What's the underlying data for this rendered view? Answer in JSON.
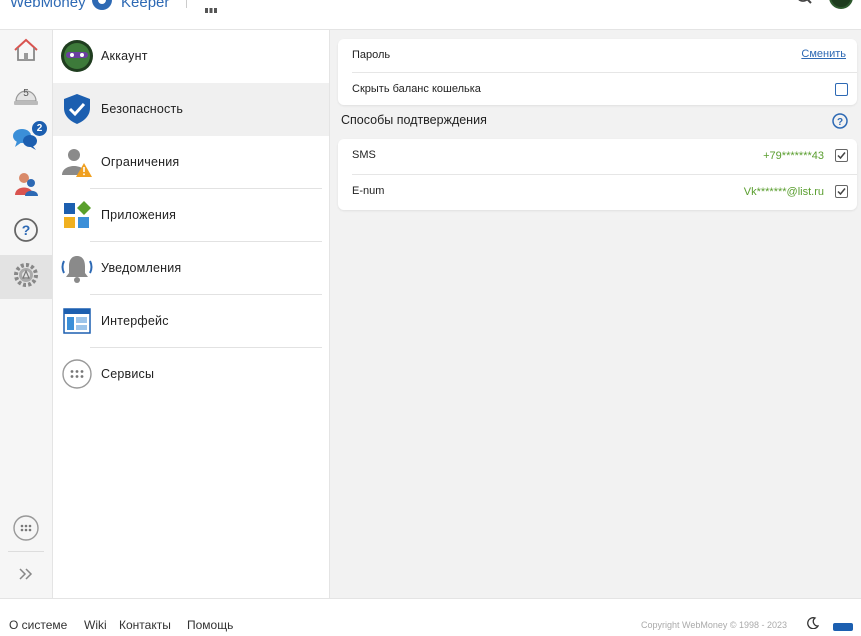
{
  "colors": {
    "accent": "#2d69b4",
    "value_green": "#5a9e2f",
    "badge": "#1c5fb0"
  },
  "header": {
    "brand": "WebMoney",
    "app_name": "Keeper"
  },
  "rail": {
    "items": [
      {
        "icon": "home-icon"
      },
      {
        "icon": "wallet-counter-icon",
        "count": "5"
      },
      {
        "icon": "chat-icon",
        "badge": "2"
      },
      {
        "icon": "contacts-icon"
      },
      {
        "icon": "help-icon"
      },
      {
        "icon": "settings-gear-icon"
      }
    ],
    "more_icon": "more-dots-icon",
    "expand_icon": "expand-chevrons-icon"
  },
  "menu": {
    "items": [
      {
        "label": "Аккаунт",
        "icon": "account-avatar-icon"
      },
      {
        "label": "Безопасность",
        "icon": "shield-check-icon"
      },
      {
        "label": "Ограничения",
        "icon": "user-warning-icon"
      },
      {
        "label": "Приложения",
        "icon": "apps-icon"
      },
      {
        "label": "Уведомления",
        "icon": "bell-icon"
      },
      {
        "label": "Интерфейс",
        "icon": "interface-window-icon"
      },
      {
        "label": "Сервисы",
        "icon": "services-dots-icon"
      }
    ]
  },
  "settings": {
    "password_label": "Пароль",
    "password_action": "Сменить",
    "hide_balance_label": "Скрыть баланс кошелька",
    "hide_balance_checked": false,
    "confirm_title": "Способы подтверждения",
    "methods": [
      {
        "label": "SMS",
        "value": "+79*******43",
        "checked": true
      },
      {
        "label": "E-num",
        "value": "Vk*******@list.ru",
        "checked": true
      }
    ]
  },
  "footer": {
    "links": [
      "О системе",
      "Wiki",
      "Контакты",
      "Помощь"
    ],
    "copyright": "Copyright WebMoney © 1998 - 2023"
  }
}
